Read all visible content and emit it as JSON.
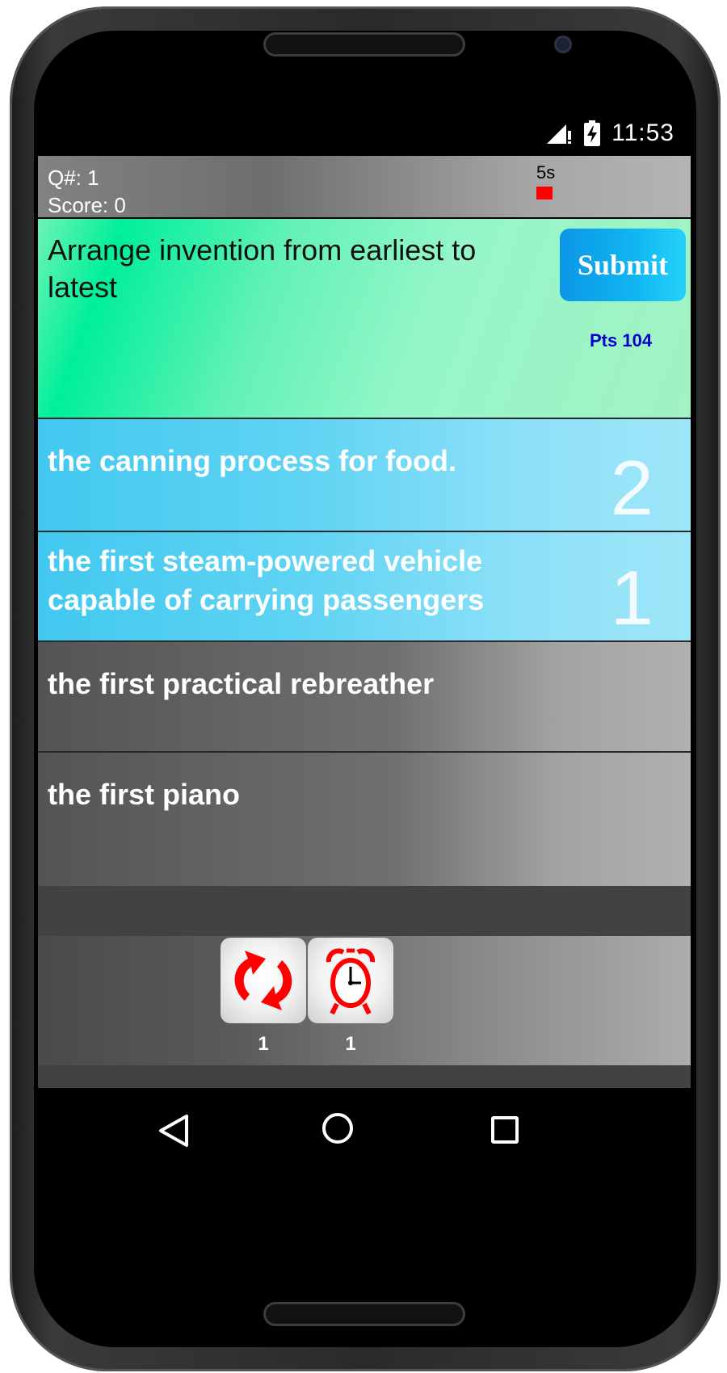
{
  "status_bar": {
    "time": "11:53",
    "icons": [
      "signal-icon",
      "battery-charging-icon"
    ]
  },
  "header": {
    "question_number": "Q#: 1",
    "score": "Score: 0",
    "timer": "5s",
    "timer_color": "#ff0000"
  },
  "question": {
    "text": "Arrange invention from earliest to latest",
    "submit_label": "Submit",
    "points": "Pts 104"
  },
  "answers": [
    {
      "text": "the canning process for food.",
      "order": "2",
      "selected": true
    },
    {
      "text": "the first steam-powered vehicle capable of carrying passengers",
      "order": "1",
      "selected": true
    },
    {
      "text": "the first practical rebreather",
      "order": "",
      "selected": false
    },
    {
      "text": "the first piano",
      "order": "",
      "selected": false
    }
  ],
  "powerups": [
    {
      "icon": "refresh-arrows-icon",
      "count": "1"
    },
    {
      "icon": "alarm-clock-icon",
      "count": "1"
    }
  ],
  "nav": {
    "icons": [
      "back-icon",
      "home-icon",
      "recent-apps-icon"
    ]
  },
  "colors": {
    "accent_green": "#00ef9a",
    "accent_blue": "#42c8f0",
    "submit_blue": "#11b6f2",
    "points_blue": "#0000cc",
    "powerup_red": "#ff0000"
  }
}
